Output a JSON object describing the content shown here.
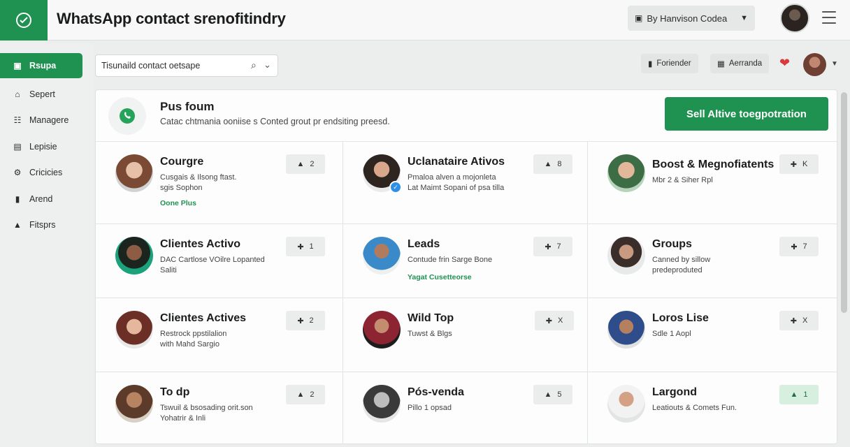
{
  "app": {
    "title": "WhatsApp contact srenofitindry"
  },
  "account": {
    "label": "By Hanvison Codea",
    "icon": "suitcase-icon"
  },
  "sidebar": {
    "items": [
      {
        "label": "Rsupa",
        "icon": "briefcase-icon",
        "active": true
      },
      {
        "label": "Sepert",
        "icon": "home-icon",
        "active": false
      },
      {
        "label": "Managere",
        "icon": "users-icon",
        "active": false
      },
      {
        "label": "Lepisie",
        "icon": "document-icon",
        "active": false
      },
      {
        "label": "Cricicies",
        "icon": "gear-icon",
        "active": false
      },
      {
        "label": "Arend",
        "icon": "phone-icon",
        "active": false
      },
      {
        "label": "Fitsprs",
        "icon": "lock-icon",
        "active": false
      }
    ]
  },
  "search": {
    "value": "Tisunaild contact oetsape"
  },
  "toolbar": {
    "btn1": {
      "label": "Foriender",
      "icon": "phone-icon"
    },
    "btn2": {
      "label": "Aerranda",
      "icon": "grid-icon"
    }
  },
  "panel": {
    "title": "Pus foum",
    "subtitle": "Catac chtmania ooniise s Conted grout pr endsiting preesd.",
    "cta_label": "Sell Altive toegpotration"
  },
  "cards": [
    {
      "name": "Courgre",
      "desc": "Cusgais & Ilsong ftast.",
      "desc2": "sgis Sophon",
      "tag": "Oone Plus",
      "badge_icon": "thumb-icon",
      "count": "2"
    },
    {
      "name": "Uclanataire Ativos",
      "desc": "Pmaloa alven a mojonleta",
      "desc2": "Lat Maimt Sopani of psa tilla",
      "tag": "",
      "badge_icon": "thumb-icon",
      "count": "8"
    },
    {
      "name": "Boost & Megnofiatents",
      "desc": "Mbr 2 & Siher Rpl",
      "desc2": "",
      "tag": "",
      "badge_icon": "plus-icon",
      "count": "K"
    },
    {
      "name": "Clientes Activo",
      "desc": "DAC Cartlose VOilre Lopanted",
      "desc2": "Saliti",
      "tag": "",
      "badge_icon": "plus-icon",
      "count": "1"
    },
    {
      "name": "Leads",
      "desc": "Contude frin Sarge Bone",
      "desc2": "",
      "tag": "Yagat Cusetteorse",
      "badge_icon": "plus-icon",
      "count": "7"
    },
    {
      "name": "Groups",
      "desc": "Canned by sillow predeproduted",
      "desc2": "",
      "tag": "",
      "badge_icon": "plus-icon",
      "count": "7"
    },
    {
      "name": "Clientes Actives",
      "desc": "Restrock ppstilalion",
      "desc2": "with Mahd Sargio",
      "tag": "",
      "badge_icon": "plus-icon",
      "count": "2"
    },
    {
      "name": "Wild Top",
      "desc": "Tuwst & Blgs",
      "desc2": "",
      "tag": "",
      "badge_icon": "plus-icon",
      "count": "X"
    },
    {
      "name": "Loros Lise",
      "desc": "Sdle 1 Aopl",
      "desc2": "",
      "tag": "",
      "badge_icon": "plus-icon",
      "count": "X"
    },
    {
      "name": "To dp",
      "desc": "Tswuil & bsosading orit.son",
      "desc2": "Yohatrir & Inli",
      "tag": "",
      "badge_icon": "thumb-icon",
      "count": "2"
    },
    {
      "name": "Pós-venda",
      "desc": "Pillo 1 opsad",
      "desc2": "",
      "tag": "",
      "badge_icon": "thumb-icon",
      "count": "5"
    },
    {
      "name": "Largond",
      "desc": "Leatiouts & Comets Fun.",
      "desc2": "",
      "tag": "",
      "badge_icon": "thumb-icon",
      "count": "1"
    }
  ]
}
